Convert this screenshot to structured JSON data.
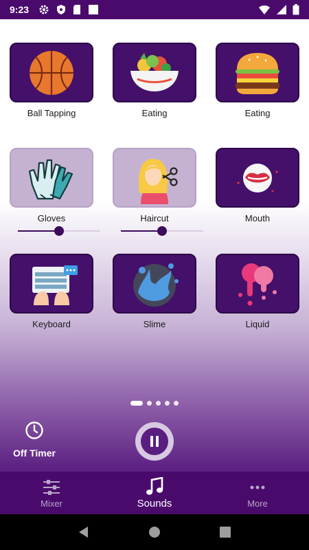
{
  "status_bar": {
    "time": "9:23",
    "icons": [
      "gear-icon",
      "shield-icon",
      "sd-card-icon",
      "square-icon",
      "wifi-icon",
      "signal-icon",
      "battery-icon"
    ]
  },
  "tiles": [
    {
      "label": "Ball Tapping",
      "icon": "basketball-icon",
      "active": false
    },
    {
      "label": "Eating",
      "icon": "salad-bowl-icon",
      "active": false
    },
    {
      "label": "Eating",
      "icon": "burger-icon",
      "active": false
    },
    {
      "label": "Gloves",
      "icon": "gloves-icon",
      "active": true,
      "volume": 0.5
    },
    {
      "label": "Haircut",
      "icon": "haircut-icon",
      "active": true,
      "volume": 0.5
    },
    {
      "label": "Mouth",
      "icon": "mouth-icon",
      "active": false
    },
    {
      "label": "Keyboard",
      "icon": "keyboard-icon",
      "active": false
    },
    {
      "label": "Slime",
      "icon": "slime-icon",
      "active": false
    },
    {
      "label": "Liquid",
      "icon": "liquid-icon",
      "active": false
    }
  ],
  "pager": {
    "count": 5,
    "current": 1
  },
  "timer": {
    "label": "Off Timer"
  },
  "player": {
    "state": "playing",
    "icon": "pause-icon"
  },
  "bottom_nav": [
    {
      "label": "Mixer",
      "icon": "sliders-icon",
      "active": false
    },
    {
      "label": "Sounds",
      "icon": "music-note-icon",
      "active": true
    },
    {
      "label": "More",
      "icon": "dots-icon",
      "active": false
    }
  ],
  "colors": {
    "brand": "#4a0a6c",
    "tile": "#44106a",
    "tile_active": "#c5b2d2"
  }
}
